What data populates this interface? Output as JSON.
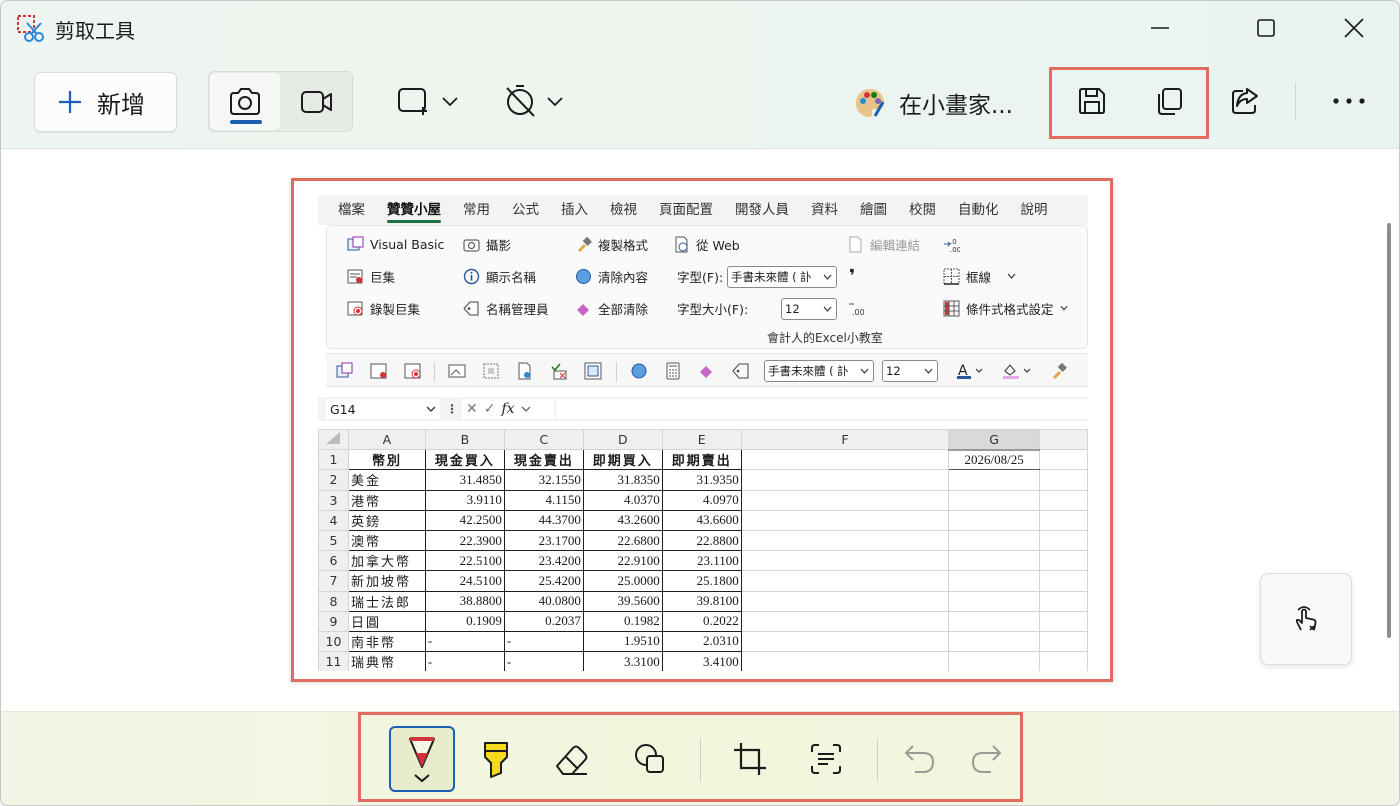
{
  "window": {
    "title": "剪取工具"
  },
  "toolbar": {
    "new_label": "新增",
    "paint_label": "在小畫家..."
  },
  "excel": {
    "tabs": [
      "檔案",
      "贊贊小屋",
      "常用",
      "公式",
      "插入",
      "檢視",
      "頁面配置",
      "開發人員",
      "資料",
      "繪圖",
      "校閱",
      "自動化",
      "說明"
    ],
    "ribbon": {
      "visual_basic": "Visual Basic",
      "macro": "巨集",
      "record_macro": "錄製巨集",
      "photo": "攝影",
      "show_name": "顯示名稱",
      "name_manager": "名稱管理員",
      "format_painter": "複製格式",
      "clear_content": "清除內容",
      "clear_all": "全部清除",
      "from_web": "從 Web",
      "font_label": "字型(F):",
      "font_value": "手書未來體 ( 訃",
      "font_size_label": "字型大小(F):",
      "font_size_value": "12",
      "edit_links": "編輯連結",
      "borders": "框線",
      "conditional_format": "條件式格式設定",
      "group_label": "會計人的Excel小教室"
    },
    "qat": {
      "font_value": "手書未來體 ( 訃",
      "size_value": "12"
    },
    "namebox": "G14",
    "fx": "fx",
    "columns": [
      "A",
      "B",
      "C",
      "D",
      "E",
      "F",
      "G"
    ],
    "rows": [
      {
        "n": "1",
        "a": "幣別",
        "b": "現金買入",
        "c": "現金賣出",
        "d": "即期買入",
        "e": "即期賣出",
        "g": "2026/08/25"
      },
      {
        "n": "2",
        "a": "美金",
        "b": "31.4850",
        "c": "32.1550",
        "d": "31.8350",
        "e": "31.9350",
        "g": ""
      },
      {
        "n": "3",
        "a": "港幣",
        "b": "3.9110",
        "c": "4.1150",
        "d": "4.0370",
        "e": "4.0970",
        "g": ""
      },
      {
        "n": "4",
        "a": "英鎊",
        "b": "42.2500",
        "c": "44.3700",
        "d": "43.2600",
        "e": "43.6600",
        "g": ""
      },
      {
        "n": "5",
        "a": "澳幣",
        "b": "22.3900",
        "c": "23.1700",
        "d": "22.6800",
        "e": "22.8800",
        "g": ""
      },
      {
        "n": "6",
        "a": "加拿大幣",
        "b": "22.5100",
        "c": "23.4200",
        "d": "22.9100",
        "e": "23.1100",
        "g": ""
      },
      {
        "n": "7",
        "a": "新加坡幣",
        "b": "24.5100",
        "c": "25.4200",
        "d": "25.0000",
        "e": "25.1800",
        "g": ""
      },
      {
        "n": "8",
        "a": "瑞士法郎",
        "b": "38.8800",
        "c": "40.0800",
        "d": "39.5600",
        "e": "39.8100",
        "g": ""
      },
      {
        "n": "9",
        "a": "日圓",
        "b": "0.1909",
        "c": "0.2037",
        "d": "0.1982",
        "e": "0.2022",
        "g": ""
      },
      {
        "n": "10",
        "a": "南非幣",
        "b": "-",
        "c": "-",
        "d": "1.9510",
        "e": "2.0310",
        "g": ""
      },
      {
        "n": "11",
        "a": "瑞典幣",
        "b": "-",
        "c": "-",
        "d": "3.3100",
        "e": "3.4100",
        "g": ""
      }
    ]
  },
  "colors": {
    "highlight_box": "#e06b5f",
    "accent": "#1a5fb4",
    "excel_green": "#1e7145"
  }
}
